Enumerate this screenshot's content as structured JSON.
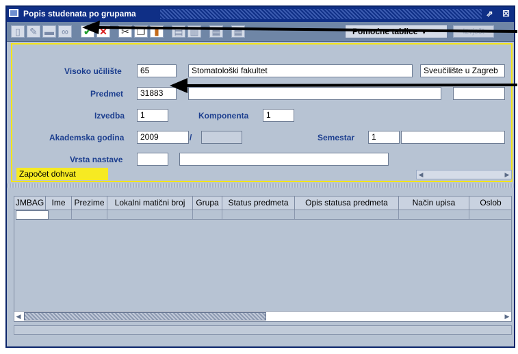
{
  "window": {
    "title": "Popis studenata po grupama",
    "controls": [
      "restore-icon",
      "close-icon"
    ]
  },
  "toolbar": {
    "buttons": [
      "new-record-icon",
      "edit-icon",
      "delete-icon",
      "search-icon",
      "confirm-icon",
      "cancel-icon",
      "cut-icon",
      "copy-icon",
      "paste-icon",
      "print-icon",
      "import-icon",
      "export-icon",
      "table-icon"
    ],
    "dropdown_label": "Pomoćne tablice ▼",
    "disabled_button": "Izvješt",
    "colors": {
      "confirm": "#1f9d2c",
      "cancel": "#d81e1e"
    }
  },
  "form": {
    "visoko_uciliste": {
      "label": "Visoko učilište",
      "code": "65",
      "name": "Stomatološki fakultet",
      "university": "Sveučilište u Zagreb"
    },
    "predmet": {
      "label": "Predmet",
      "code": "31883",
      "name": "",
      "extra": ""
    },
    "izvedba": {
      "label": "Izvedba",
      "value": "1"
    },
    "komponenta": {
      "label": "Komponenta",
      "value": "1"
    },
    "akademska_godina": {
      "label": "Akademska godina",
      "value": "2009",
      "separator": "/",
      "value2": ""
    },
    "semestar": {
      "label": "Semestar",
      "value": "1",
      "name": ""
    },
    "vrsta_nastave": {
      "label": "Vrsta nastave",
      "code": "",
      "name": ""
    },
    "status": "Započet dohvat"
  },
  "table": {
    "columns": [
      "JMBAG",
      "Ime",
      "Prezime",
      "Lokalni matični broj",
      "Grupa",
      "Status predmeta",
      "Opis statusa predmeta",
      "Način upisa",
      "Oslob"
    ]
  },
  "colors": {
    "accent": "#f3e419",
    "titlebar": "#0f2f86",
    "label": "#1d3f8f",
    "background": "#b7c3d3"
  }
}
